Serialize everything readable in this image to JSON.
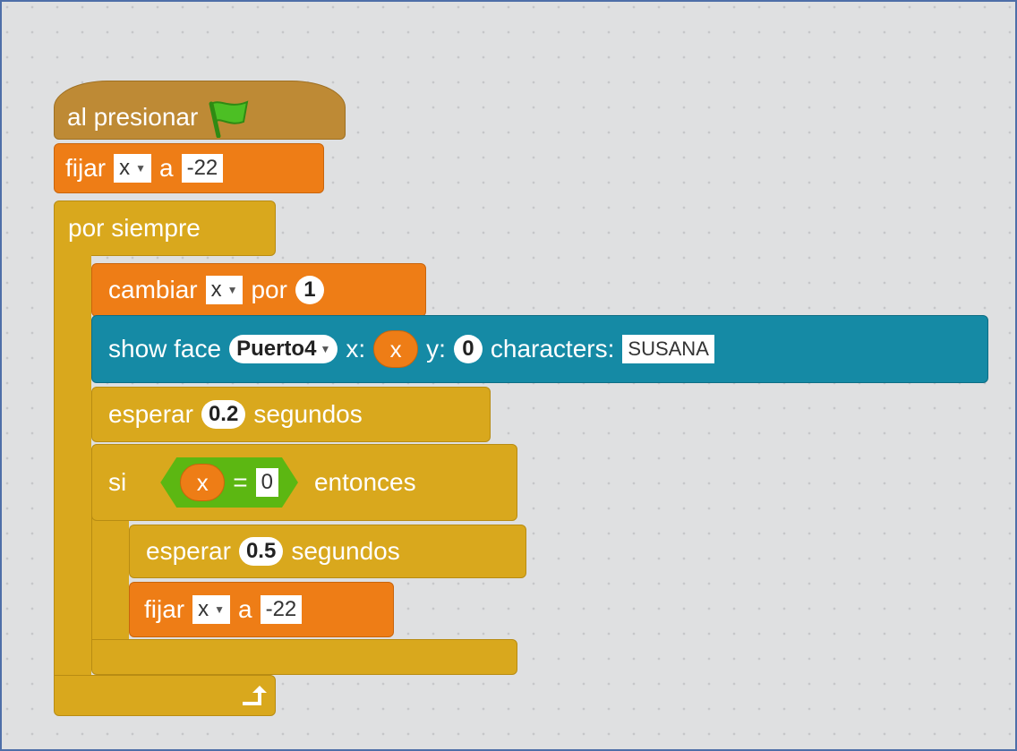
{
  "colors": {
    "events": "#be8a35",
    "control": "#d9a81d",
    "data": "#ee7d16",
    "extension": "#158aa5",
    "operators": "#5cb712"
  },
  "script": {
    "hat": {
      "label": "al presionar",
      "icon": "green-flag-icon"
    },
    "set1": {
      "label": "fijar",
      "var": "x",
      "to": "a",
      "value": "-22"
    },
    "forever": {
      "label": "por siempre",
      "loop_icon": "loop-arrow-icon"
    },
    "change": {
      "label": "cambiar",
      "var": "x",
      "by": "por",
      "value": "1"
    },
    "show": {
      "label": "show face",
      "face": "Puerto4",
      "x_label": "x:",
      "x_value": "x",
      "y_label": "y:",
      "y_value": "0",
      "chars_label": "characters:",
      "chars_value": "SUSANA"
    },
    "wait1": {
      "label": "esperar",
      "value": "0.2",
      "unit": "segundos"
    },
    "if": {
      "label": "si",
      "left": "x",
      "op": "=",
      "right": "0",
      "then": "entonces"
    },
    "wait2": {
      "label": "esperar",
      "value": "0.5",
      "unit": "segundos"
    },
    "set2": {
      "label": "fijar",
      "var": "x",
      "to": "a",
      "value": "-22"
    }
  }
}
